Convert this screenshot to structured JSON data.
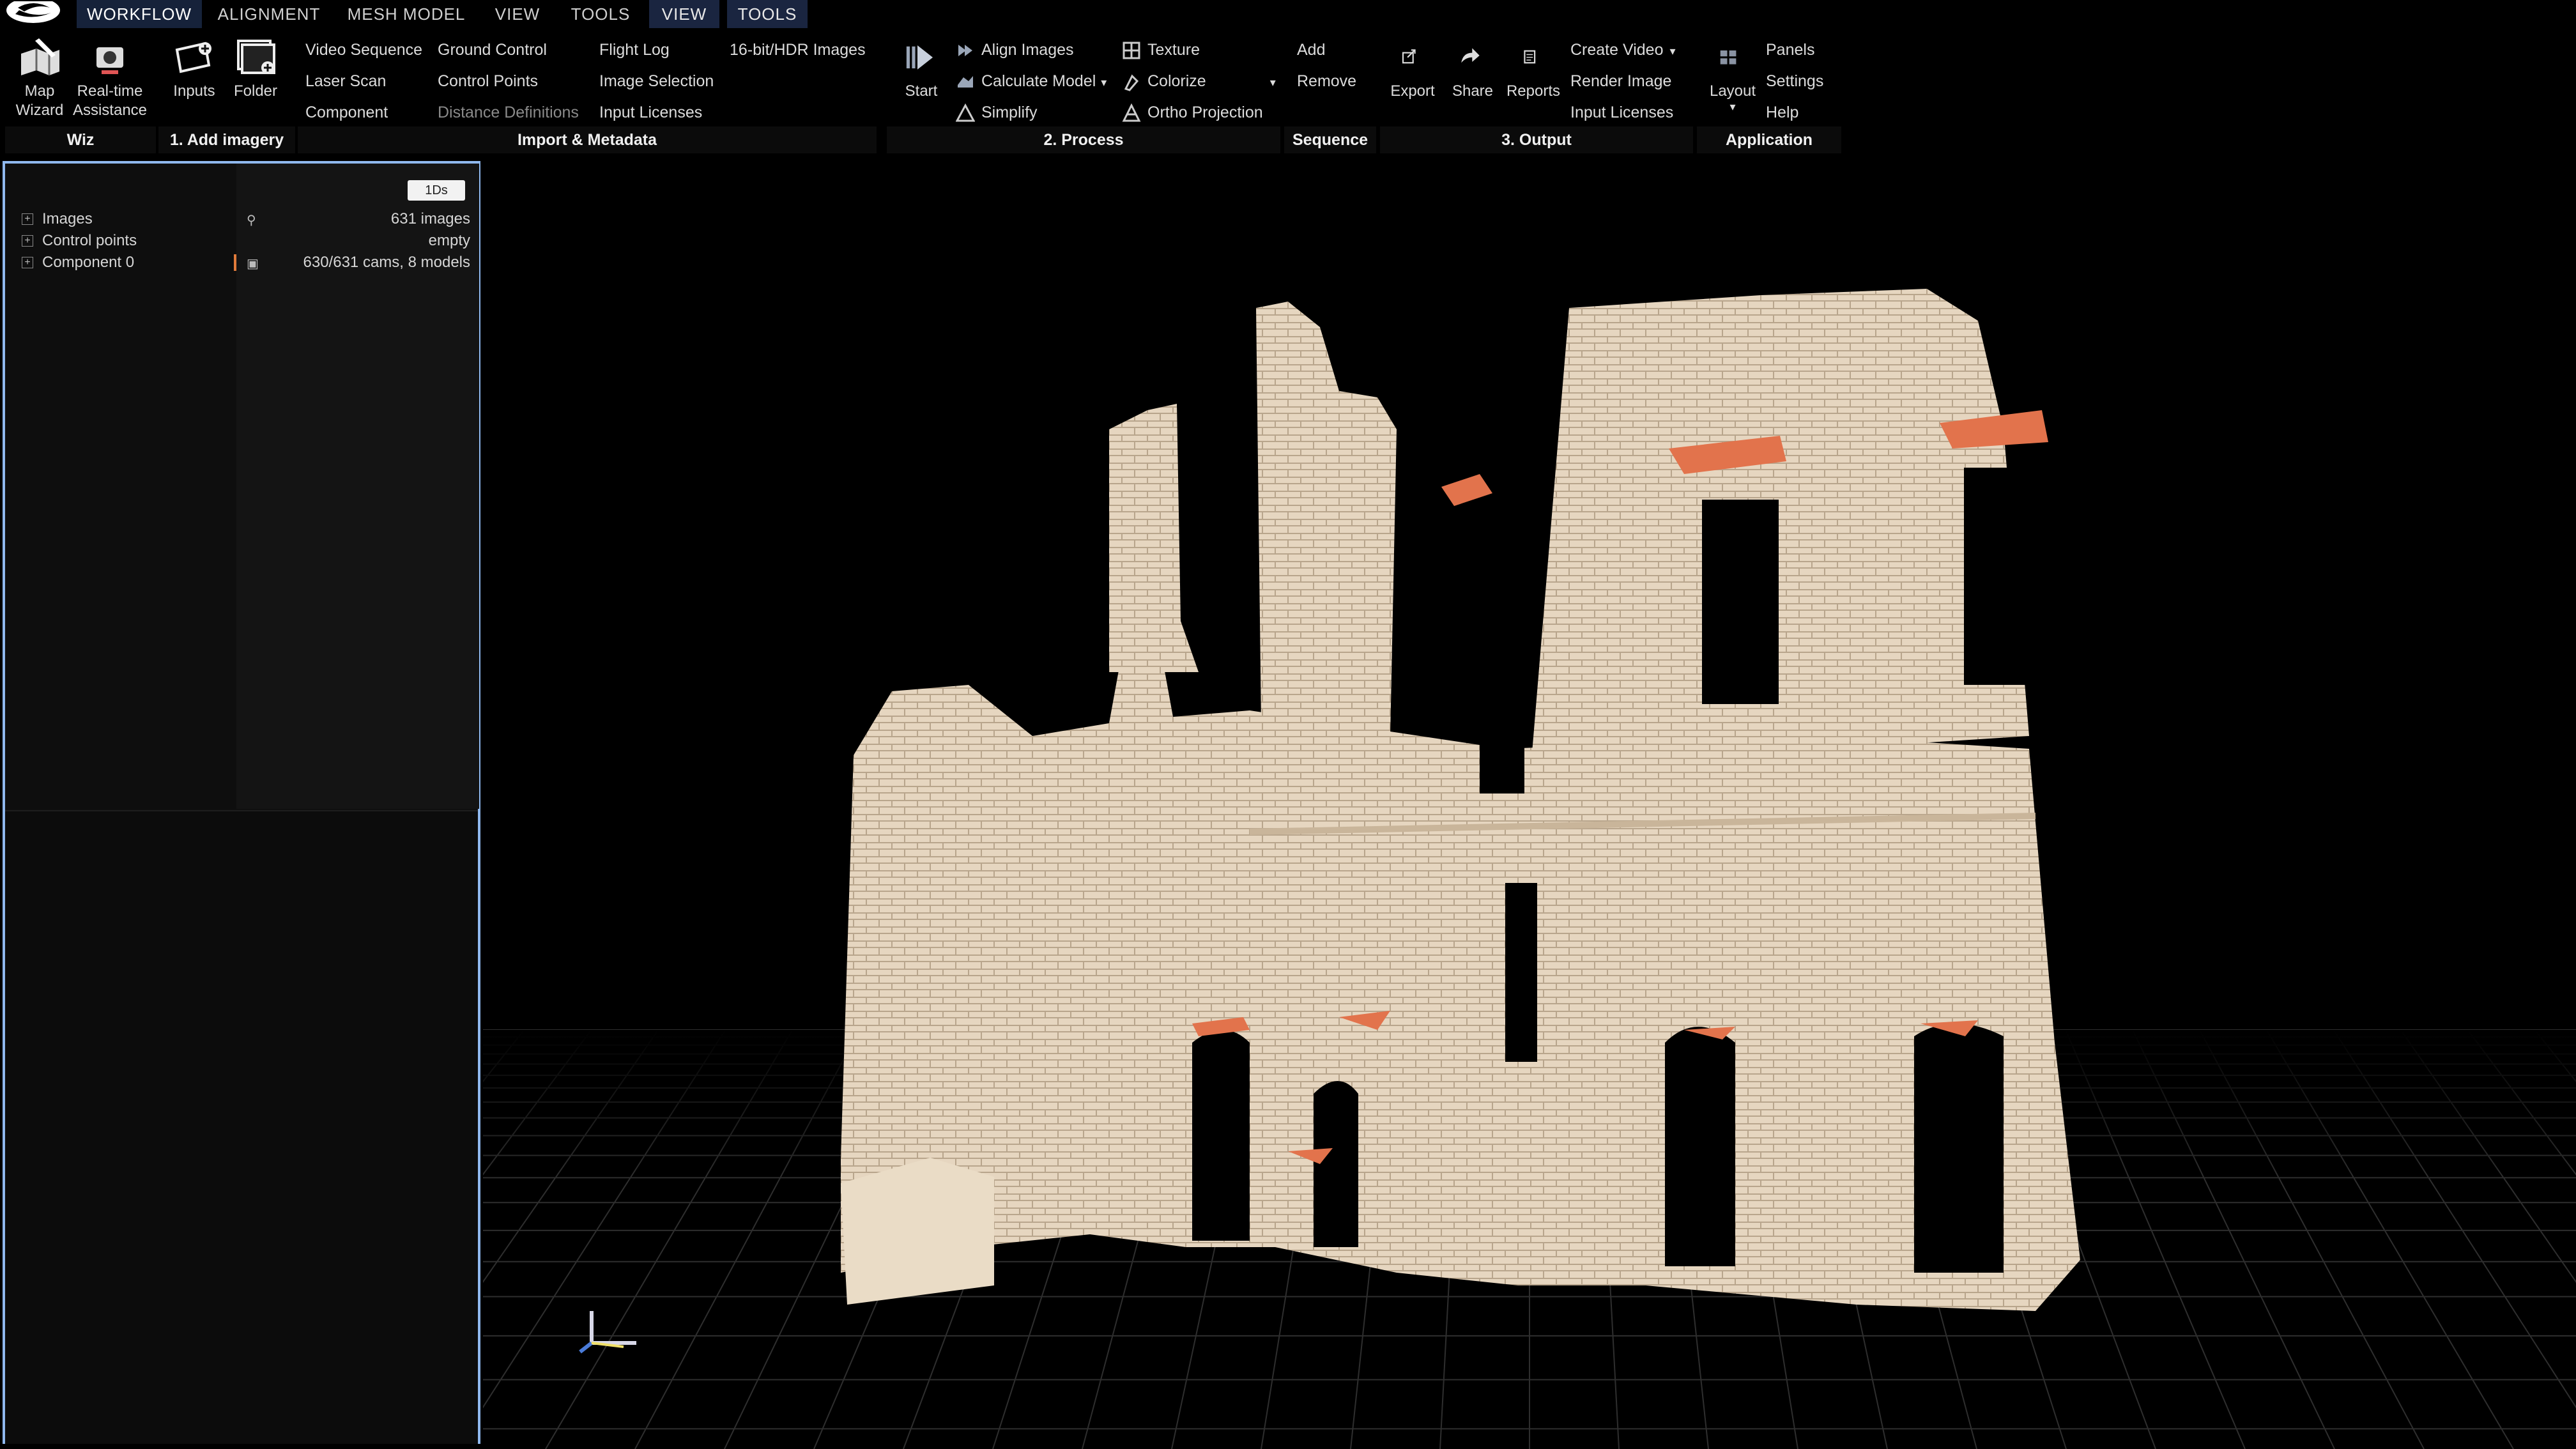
{
  "menu_tabs": [
    "WORKFLOW",
    "ALIGNMENT",
    "MESH MODEL",
    "VIEW",
    "TOOLS",
    "VIEW",
    "TOOLS"
  ],
  "ribbon": {
    "wizard": {
      "map_wizard": "Map\nWizard",
      "realtime": "Real-time\nAssistance"
    },
    "add_imagery": {
      "inputs": "Inputs",
      "folder": "Folder"
    },
    "import_col1": [
      "Video Sequence",
      "Laser Scan",
      "Component"
    ],
    "import_col2": [
      "Ground Control",
      "Control Points",
      "Distance Definitions"
    ],
    "import_col3": [
      "Flight Log",
      "Image Selection",
      "Input Licenses"
    ],
    "import_col4": [
      "16-bit/HDR Images"
    ],
    "process_start": "Start",
    "process_col1": [
      "Align Images",
      "Calculate Model",
      "Simplify"
    ],
    "process_col2": [
      "Texture",
      "Colorize",
      "Ortho Projection"
    ],
    "sequence": [
      "Add",
      "Remove"
    ],
    "output_btns": [
      "Export",
      "Share",
      "Reports"
    ],
    "output_col": [
      "Create Video",
      "Render Image",
      "Input Licenses"
    ],
    "application": {
      "layout": "Layout",
      "items": [
        "Panels",
        "Settings",
        "Help"
      ]
    },
    "groups": [
      "Wiz",
      "1. Add imagery",
      "Import & Metadata",
      "2. Process",
      "Sequence",
      "3. Output",
      "Application"
    ]
  },
  "left_panel": {
    "badge": "1Ds",
    "tree": [
      {
        "label": "Images",
        "value": "631 images"
      },
      {
        "label": "Control points",
        "value": "empty"
      },
      {
        "label": "Component 0",
        "value": "630/631 cams, 8 models"
      }
    ]
  },
  "colors": {
    "accent": "#8fb8ee",
    "active_tab": "#16223a",
    "model_base": "#e3d3be",
    "model_highlight": "#e2734c"
  },
  "icons": [
    "logo-icon",
    "map-wizard-icon",
    "realtime-assistance-icon",
    "inputs-icon",
    "folder-icon",
    "start-icon",
    "align-icon",
    "calculate-icon",
    "simplify-icon",
    "texture-icon",
    "colorize-icon",
    "ortho-icon",
    "export-icon",
    "share-icon",
    "reports-icon",
    "layout-icon",
    "axis-gizmo-icon"
  ]
}
